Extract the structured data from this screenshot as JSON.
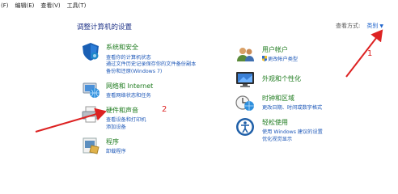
{
  "menu": [
    "(F)",
    "编辑(E)",
    "查看(V)",
    "工具(T)"
  ],
  "page_title": "调整计算机的设置",
  "view_by": {
    "label": "查看方式:",
    "value": "类别"
  },
  "left_categories": [
    {
      "title": "系统和安全",
      "links": [
        "查看你的计算机状态",
        "通过文件历史记录保存你的文件备份副本",
        "备份和还原(Windows 7)"
      ]
    },
    {
      "title": "网络和 Internet",
      "links": [
        "查看网络状态和任务"
      ]
    },
    {
      "title": "硬件和声音",
      "links": [
        "查看设备和打印机",
        "添加设备"
      ]
    },
    {
      "title": "程序",
      "links": [
        "卸载程序"
      ]
    }
  ],
  "right_categories": [
    {
      "title": "用户帐户",
      "links": [
        "更改帐户类型"
      ]
    },
    {
      "title": "外观和个性化",
      "links": []
    },
    {
      "title": "时钟和区域",
      "links": [
        "更改日期、时间或数字格式"
      ]
    },
    {
      "title": "轻松使用",
      "links": [
        "使用 Windows 建议的设置",
        "优化视觉显示"
      ]
    }
  ],
  "annotations": {
    "one": "1",
    "two": "2"
  },
  "colors": {
    "category_title": "#1e7b1e",
    "link": "#1e58b8",
    "annotation": "#dd2222",
    "page_title": "#1e3287"
  }
}
